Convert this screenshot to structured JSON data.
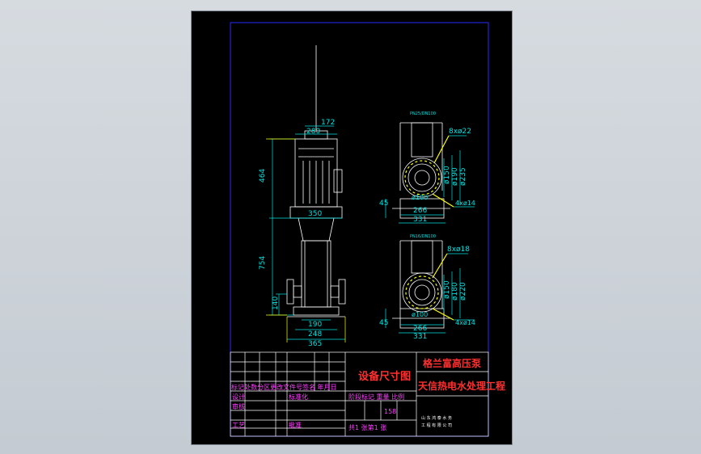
{
  "colors": {
    "background": "#000000",
    "border": "#2a2aff",
    "outline": "#ffffff",
    "dimension": "#00e0e0",
    "highlight": "#ffff00",
    "title_text": "#ff3030",
    "table_text": "#ff40ff"
  },
  "front_view": {
    "dims": {
      "top_width_172": "172",
      "motor_width_280": "280",
      "motor_height_464": "464",
      "flange_width_350": "350",
      "pump_height_754": "754",
      "base_height_140": "140",
      "base_190": "190",
      "base_248": "248",
      "base_365": "365"
    }
  },
  "side_view_top": {
    "label": "PN25/DN100",
    "dims": {
      "bolts_top": "8xø22",
      "d150": "ø150",
      "d190": "ø190",
      "d235": "ø235",
      "height_45": "45",
      "d100": "ø100",
      "w266": "266",
      "w331": "331",
      "bolts_bottom": "4xø14"
    }
  },
  "side_view_bottom": {
    "label": "PN16/DN100",
    "dims": {
      "bolts_top": "8xø18",
      "d150": "ø150",
      "d180": "ø180",
      "d220": "ø220",
      "height_45": "45",
      "d100": "ø100",
      "w266": "266",
      "w331": "331",
      "bolts_bottom": "4xø14"
    }
  },
  "title_block": {
    "drawing_title": "设备尺寸图",
    "product_name": "格兰富高压泵",
    "project_name": "天信热电水处理工程",
    "revision_header": "标记处数分区更改文件号签名 年月日",
    "row_design": "设计",
    "row_design_sign": "标准化",
    "row_check": "审核",
    "row_process": "工艺",
    "row_approve": "批准",
    "stage_label": "阶段标记 重量 比例",
    "weight": "158",
    "sheet_info": "共1 张第1 张",
    "company_line1": "山 东 鸿 泰 水 务",
    "company_line2": "工 程 有 限 公 司"
  }
}
